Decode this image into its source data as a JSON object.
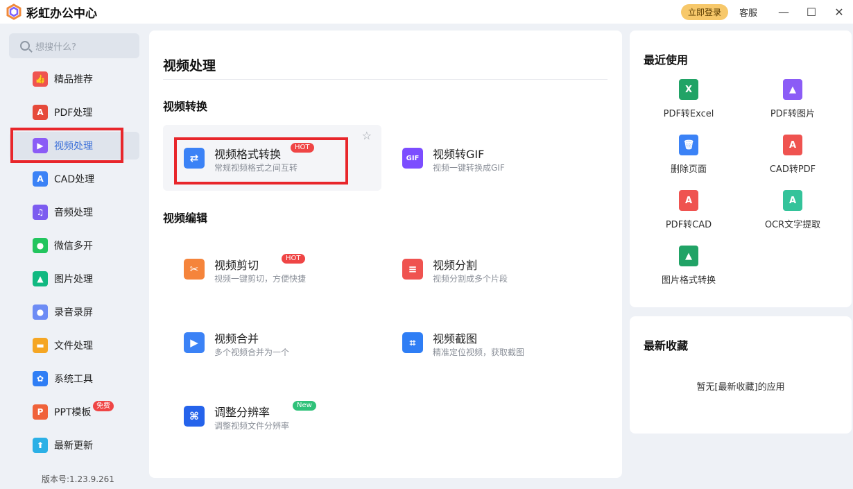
{
  "app": {
    "title": "彩虹办公中心"
  },
  "titlebar": {
    "login": "立即登录",
    "service": "客服",
    "minimize": "—",
    "maximize": "☐",
    "close": "✕"
  },
  "search": {
    "placeholder": "想搜什么?"
  },
  "sidebar": {
    "items": [
      {
        "label": "精品推荐",
        "icon": "thumbs-up-icon",
        "color": "#ef5350",
        "glyph": "👍"
      },
      {
        "label": "PDF处理",
        "icon": "pdf-icon",
        "color": "#e64a3b",
        "glyph": "A"
      },
      {
        "label": "视频处理",
        "icon": "video-play-icon",
        "color": "#8b5cf6",
        "glyph": "▶"
      },
      {
        "label": "CAD处理",
        "icon": "cad-icon",
        "color": "#3b82f6",
        "glyph": "A"
      },
      {
        "label": "音频处理",
        "icon": "music-icon",
        "color": "#7c5cf0",
        "glyph": "♫"
      },
      {
        "label": "微信多开",
        "icon": "wechat-icon",
        "color": "#22c55e",
        "glyph": "●"
      },
      {
        "label": "图片处理",
        "icon": "image-icon",
        "color": "#10b981",
        "glyph": "▲"
      },
      {
        "label": "录音录屏",
        "icon": "microphone-icon",
        "color": "#6d8cf5",
        "glyph": "●"
      },
      {
        "label": "文件处理",
        "icon": "folder-icon",
        "color": "#f5a623",
        "glyph": "▬"
      },
      {
        "label": "系统工具",
        "icon": "gear-icon",
        "color": "#2f7ef5",
        "glyph": "✿"
      },
      {
        "label": "PPT模板",
        "icon": "ppt-icon",
        "color": "#f0623a",
        "glyph": "P",
        "badge": "免费"
      },
      {
        "label": "最新更新",
        "icon": "upload-icon",
        "color": "#2bb0e6",
        "glyph": "⬆"
      }
    ],
    "version": "版本号:1.23.9.261"
  },
  "main": {
    "title": "视频处理",
    "sections": [
      {
        "title": "视频转换",
        "tools": [
          {
            "name": "视频格式转换",
            "desc": "常规视频格式之间互转",
            "badge": "HOT",
            "icon": "convert-arrows-icon",
            "color": "#3b82f6",
            "glyph": "⇄"
          },
          {
            "name": "视频转GIF",
            "desc": "视频一键转换成GIF",
            "icon": "gif-icon",
            "color": "#7c4dff",
            "glyph": "GIF"
          }
        ]
      },
      {
        "title": "视频编辑",
        "tools": [
          {
            "name": "视频剪切",
            "desc": "视频一键剪切，方便快捷",
            "badge": "HOT",
            "icon": "video-cut-icon",
            "color": "#f5843b",
            "glyph": "✂"
          },
          {
            "name": "视频分割",
            "desc": "视频分割成多个片段",
            "icon": "split-icon",
            "color": "#ef5350",
            "glyph": "≡"
          },
          {
            "name": "视频合并",
            "desc": "多个视频合并为一个",
            "icon": "merge-icon",
            "color": "#3b82f6",
            "glyph": "▶"
          },
          {
            "name": "视频截图",
            "desc": "精准定位视频，获取截图",
            "icon": "crop-icon",
            "color": "#2f7ef5",
            "glyph": "⌗"
          },
          {
            "name": "调整分辨率",
            "desc": "调整视频文件分辨率",
            "badge": "New",
            "icon": "resolution-icon",
            "color": "#2563eb",
            "glyph": "⌘"
          }
        ]
      }
    ],
    "favorite_star": "☆"
  },
  "recent": {
    "title": "最近使用",
    "items": [
      {
        "label": "PDF转Excel",
        "icon": "pdf-to-excel-icon",
        "color": "#21a366",
        "glyph": "X"
      },
      {
        "label": "PDF转图片",
        "icon": "pdf-to-image-icon",
        "color": "#8b5cf6",
        "glyph": "▲"
      },
      {
        "label": "删除页面",
        "icon": "delete-page-icon",
        "color": "#3b82f6",
        "glyph": "🗑"
      },
      {
        "label": "CAD转PDF",
        "icon": "cad-to-pdf-icon",
        "color": "#ef5350",
        "glyph": "A"
      },
      {
        "label": "PDF转CAD",
        "icon": "pdf-to-cad-icon",
        "color": "#ef5350",
        "glyph": "A"
      },
      {
        "label": "OCR文字提取",
        "icon": "ocr-icon",
        "color": "#34c39a",
        "glyph": "A"
      },
      {
        "label": "图片格式转换",
        "icon": "image-convert-icon",
        "color": "#21a366",
        "glyph": "▲"
      }
    ]
  },
  "favorites": {
    "title": "最新收藏",
    "empty": "暂无[最新收藏]的应用"
  }
}
